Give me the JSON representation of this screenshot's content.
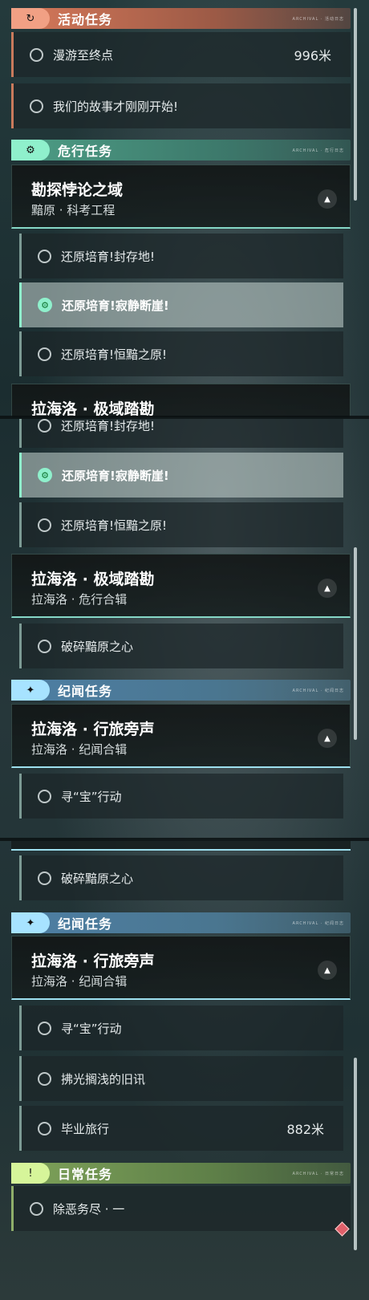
{
  "panel1": {
    "activity_header": {
      "label": "活动任务",
      "icon": "activity-icon",
      "tag": "ARCHIVAL · 活动日志"
    },
    "activity_rows": [
      {
        "label": "漫游至终点",
        "distance": "996米"
      },
      {
        "label": "我们的故事才刚刚开始!"
      }
    ],
    "risk_header": {
      "label": "危行任务",
      "icon": "gear-icon",
      "tag": "ARCHIVAL · 危行日志"
    },
    "card1": {
      "title": "勘探悖论之域",
      "subtitle": "黯原 · 科考工程"
    },
    "card1_rows": [
      {
        "label": "还原培育!封存地!"
      },
      {
        "label": "还原培育!寂静断崖!",
        "selected": true
      },
      {
        "label": "还原培育!恒黯之原!"
      }
    ],
    "card2_partial_title": "拉海洛 · 极域踏勘"
  },
  "panel2": {
    "rows_top": [
      {
        "label": "还原培育!封存地!"
      },
      {
        "label": "还原培育!寂静断崖!",
        "selected": true
      },
      {
        "label": "还原培育!恒黯之原!"
      }
    ],
    "card2": {
      "title": "拉海洛 · 极域踏勘",
      "subtitle": "拉海洛 · 危行合辑"
    },
    "card2_rows": [
      {
        "label": "破碎黯原之心"
      }
    ],
    "lore_header": {
      "label": "纪闻任务",
      "icon": "sparkle-icon",
      "tag": "ARCHIVAL · 纪闻日志"
    },
    "card3": {
      "title": "拉海洛 · 行旅旁声",
      "subtitle": "拉海洛 · 纪闻合辑"
    },
    "card3_rows": [
      {
        "label": "寻“宝”行动"
      }
    ]
  },
  "panel3": {
    "rows_top": [
      {
        "label": "破碎黯原之心"
      }
    ],
    "lore_header": {
      "label": "纪闻任务",
      "icon": "sparkle-icon",
      "tag": "ARCHIVAL · 纪闻日志"
    },
    "card3": {
      "title": "拉海洛 · 行旅旁声",
      "subtitle": "拉海洛 · 纪闻合辑"
    },
    "card3_rows": [
      {
        "label": "寻“宝”行动"
      },
      {
        "label": "拂光搁浅的旧讯"
      },
      {
        "label": "毕业旅行",
        "distance": "882米"
      }
    ],
    "daily_header": {
      "label": "日常任务",
      "icon": "alert-icon",
      "tag": "ARCHIVAL · 日常日志"
    },
    "daily_rows": [
      {
        "label": "除恶务尽 · 一"
      }
    ]
  },
  "colors": {
    "activity": "#d7795a",
    "risk": "#4e9e86",
    "lore": "#4e7fa4",
    "daily": "#7fa35a",
    "selected": "#8ff0cc",
    "marker": "#e0606a"
  }
}
